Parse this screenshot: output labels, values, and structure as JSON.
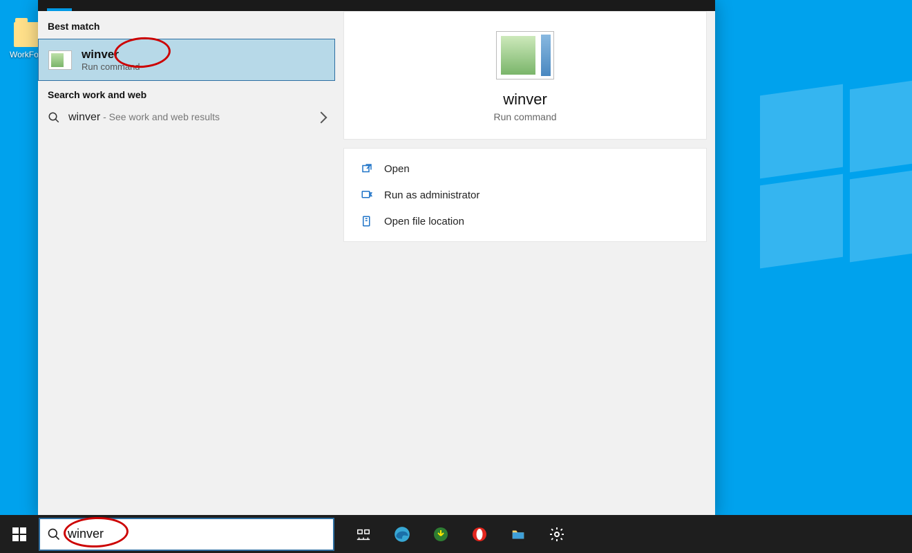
{
  "desktop": {
    "icon_label": "WorkFolder"
  },
  "search": {
    "best_match_header": "Best match",
    "best_match": {
      "title": "winver",
      "subtitle": "Run command"
    },
    "web_header": "Search work and web",
    "web_row": {
      "query": "winver",
      "hint": " - See work and web results"
    },
    "preview": {
      "title": "winver",
      "subtitle": "Run command"
    },
    "actions": {
      "open": "Open",
      "run_admin": "Run as administrator",
      "open_location": "Open file location"
    },
    "input_value": "winver"
  },
  "taskbar": {
    "items": [
      "task-view",
      "edge",
      "downloader",
      "opera",
      "file-explorer",
      "settings"
    ]
  }
}
